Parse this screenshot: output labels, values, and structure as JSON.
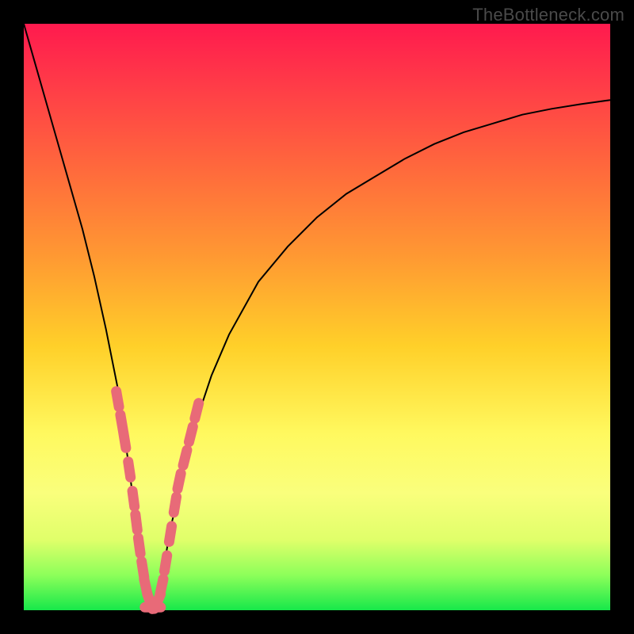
{
  "watermark": "TheBottleneck.com",
  "colors": {
    "gradient_top": "#ff1a4e",
    "gradient_bottom": "#17e84a",
    "curve": "#000000",
    "marker": "#e86a78",
    "frame_bg": "#000000"
  },
  "chart_data": {
    "type": "line",
    "title": "",
    "xlabel": "",
    "ylabel": "",
    "xlim": [
      0,
      100
    ],
    "ylim": [
      0,
      100
    ],
    "series": [
      {
        "name": "bottleneck-curve",
        "x": [
          0,
          2,
          4,
          6,
          8,
          10,
          12,
          14,
          16,
          18,
          19,
          20,
          21,
          22,
          23,
          24,
          25,
          26,
          27,
          28,
          30,
          32,
          35,
          40,
          45,
          50,
          55,
          60,
          65,
          70,
          75,
          80,
          85,
          90,
          95,
          100
        ],
        "y": [
          100,
          93,
          86,
          79,
          72,
          65,
          57,
          48,
          38,
          24,
          16,
          8,
          2,
          0,
          2,
          8,
          14,
          18,
          23,
          27,
          34,
          40,
          47,
          56,
          62,
          67,
          71,
          74,
          77,
          79.5,
          81.5,
          83,
          84.5,
          85.5,
          86.3,
          87
        ]
      }
    ],
    "markers": {
      "name": "highlight-cluster",
      "points": [
        {
          "x": 16.0,
          "y": 36
        },
        {
          "x": 16.7,
          "y": 32
        },
        {
          "x": 17.2,
          "y": 29
        },
        {
          "x": 18.0,
          "y": 24
        },
        {
          "x": 18.7,
          "y": 19
        },
        {
          "x": 19.2,
          "y": 15
        },
        {
          "x": 19.7,
          "y": 11
        },
        {
          "x": 20.3,
          "y": 7
        },
        {
          "x": 20.8,
          "y": 4
        },
        {
          "x": 21.5,
          "y": 1.5
        },
        {
          "x": 22.0,
          "y": 0.5
        },
        {
          "x": 22.8,
          "y": 1.5
        },
        {
          "x": 23.5,
          "y": 4
        },
        {
          "x": 24.2,
          "y": 8
        },
        {
          "x": 25.0,
          "y": 13
        },
        {
          "x": 25.8,
          "y": 18
        },
        {
          "x": 26.5,
          "y": 22
        },
        {
          "x": 27.5,
          "y": 26
        },
        {
          "x": 28.5,
          "y": 30
        },
        {
          "x": 29.5,
          "y": 34
        }
      ]
    }
  }
}
